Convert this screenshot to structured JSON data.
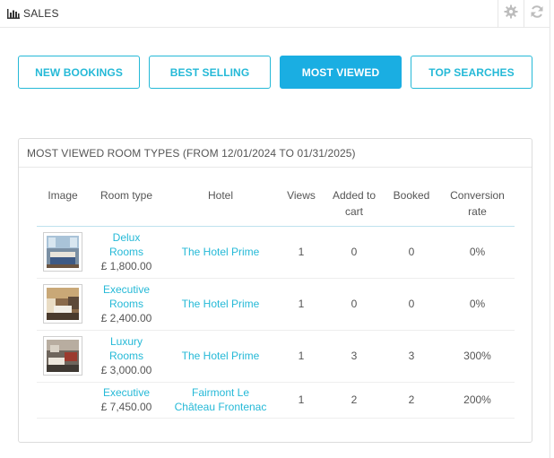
{
  "header": {
    "title": "SALES",
    "icons": {
      "chart": "bar-chart-icon",
      "config": "gear-icon",
      "refresh": "refresh-icon"
    }
  },
  "tabs": [
    {
      "label": "NEW BOOKINGS",
      "active": false
    },
    {
      "label": "BEST SELLING",
      "active": false
    },
    {
      "label": "MOST VIEWED",
      "active": true
    },
    {
      "label": "TOP SEARCHES",
      "active": false
    }
  ],
  "card": {
    "title": "MOST VIEWED ROOM TYPES (FROM 12/01/2024 TO 01/31/2025)"
  },
  "table": {
    "headers": {
      "image": "Image",
      "room_type": "Room type",
      "hotel": "Hotel",
      "views": "Views",
      "added_line1": "Added to",
      "added_line2": "cart",
      "booked": "Booked",
      "conversion_line1": "Conversion",
      "conversion_line2": "rate"
    },
    "rows": [
      {
        "room_line1": "Delux",
        "room_line2": "Rooms",
        "price": "£ 1,800.00",
        "hotel_line1": "The Hotel Prime",
        "hotel_line2": "",
        "views": "1",
        "added": "0",
        "booked": "0",
        "conversion": "0%"
      },
      {
        "room_line1": "Executive",
        "room_line2": "Rooms",
        "price": "£ 2,400.00",
        "hotel_line1": "The Hotel Prime",
        "hotel_line2": "",
        "views": "1",
        "added": "0",
        "booked": "0",
        "conversion": "0%"
      },
      {
        "room_line1": "Luxury",
        "room_line2": "Rooms",
        "price": "£ 3,000.00",
        "hotel_line1": "The Hotel Prime",
        "hotel_line2": "",
        "views": "1",
        "added": "3",
        "booked": "3",
        "conversion": "300%"
      },
      {
        "room_line1": "Executive",
        "room_line2": "",
        "price": "£ 7,450.00",
        "hotel_line1": "Fairmont Le",
        "hotel_line2": "Château Frontenac",
        "views": "1",
        "added": "2",
        "booked": "2",
        "conversion": "200%"
      }
    ]
  },
  "colors": {
    "accent": "#25b9d7",
    "active_tab": "#1aaee2",
    "text": "#555555"
  }
}
